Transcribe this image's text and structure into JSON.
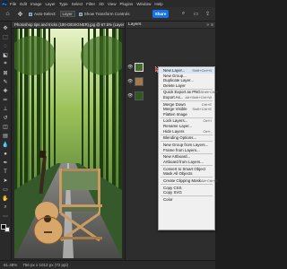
{
  "menubar": {
    "logo": "Ps",
    "items": [
      "File",
      "Edit",
      "Image",
      "Layer",
      "Type",
      "Select",
      "Filter",
      "3D",
      "View",
      "Plugins",
      "Window",
      "Help"
    ]
  },
  "options": {
    "auto_select_label": "Auto-Select:",
    "target_value": "Layer",
    "show_transform_label": "Show Transform Controls",
    "share_label": "Share"
  },
  "document": {
    "tab_title": "Photoshop tips and tricks (180-DESIGNER).jpg @ 67.5% (Layer 1, R..."
  },
  "status": {
    "zoom": "61.48%",
    "dimensions": "756 px x 1012 px (72 ppi)"
  },
  "panel": {
    "title": "Layers"
  },
  "context_menu": {
    "items": [
      {
        "label": "New Layer...",
        "shortcut": "Shift+Ctrl+N"
      },
      {
        "label": "New Group...",
        "shortcut": ""
      },
      {
        "label": "Duplicate Layer...",
        "shortcut": ""
      },
      {
        "label": "Delete Layer",
        "shortcut": ""
      },
      {
        "label": "Quick Export as PNG",
        "shortcut": "Shift+Ctrl+'"
      },
      {
        "label": "Export As...",
        "shortcut": "Alt+Shift+Ctrl+W"
      },
      {
        "label": "Merge Down",
        "shortcut": "Ctrl+E"
      },
      {
        "label": "Merge Visible",
        "shortcut": "Shift+Ctrl+E"
      },
      {
        "label": "Flatten Image",
        "shortcut": ""
      },
      {
        "label": "Lock Layers...",
        "shortcut": "Ctrl+/"
      },
      {
        "label": "Rename Layer...",
        "shortcut": ""
      },
      {
        "label": "Hide Layers",
        "shortcut": "Ctrl+,"
      },
      {
        "label": "Blending Options...",
        "shortcut": ""
      },
      {
        "label": "New Group from Layers...",
        "shortcut": ""
      },
      {
        "label": "Frame from Layers...",
        "shortcut": ""
      },
      {
        "label": "New Artboard...",
        "shortcut": ""
      },
      {
        "label": "Artboard from Layers...",
        "shortcut": ""
      },
      {
        "label": "Convert to Smart Object",
        "shortcut": ""
      },
      {
        "label": "Mask All Objects",
        "shortcut": ""
      },
      {
        "label": "Create Clipping Mask",
        "shortcut": "Alt+Ctrl+G"
      },
      {
        "label": "Copy CSS",
        "shortcut": ""
      },
      {
        "label": "Copy SVG",
        "shortcut": ""
      },
      {
        "label": "Color",
        "shortcut": ""
      }
    ]
  },
  "colors": {
    "accent": "#1473e6",
    "menu_bg": "#f0f0f0",
    "highlight": "#d9e6f5"
  }
}
